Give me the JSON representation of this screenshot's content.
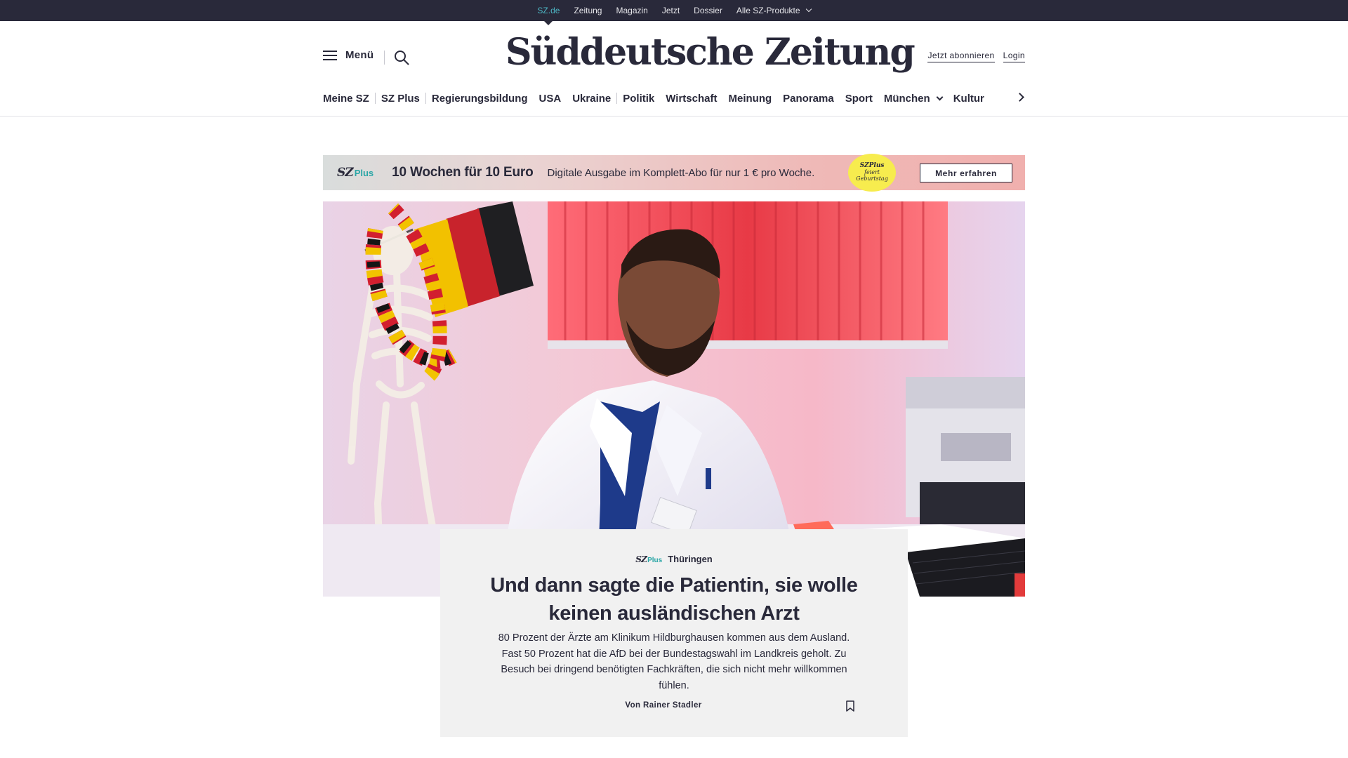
{
  "topbar": {
    "items": [
      {
        "label": "SZ.de",
        "active": true
      },
      {
        "label": "Zeitung"
      },
      {
        "label": "Magazin"
      },
      {
        "label": "Jetzt"
      },
      {
        "label": "Dossier"
      },
      {
        "label": "Alle SZ-Produkte",
        "dropdown": true
      }
    ]
  },
  "header": {
    "menu_label": "Menü",
    "logo": "Süddeutsche Zeitung",
    "subscribe": "Jetzt abonnieren",
    "login": "Login"
  },
  "sections": {
    "items": [
      "Meine SZ",
      "SZ Plus",
      "Regierungsbildung",
      "USA",
      "Ukraine",
      "Politik",
      "Wirtschaft",
      "Meinung",
      "Panorama",
      "Sport",
      "München",
      "Kultur"
    ]
  },
  "promo": {
    "logo_sz": "SZ",
    "logo_plus": "Plus",
    "title": "10 Wochen für 10 Euro",
    "text": "Digitale Ausgabe im Komplett-Abo für nur 1 € pro Woche.",
    "badge_line1": "SZPlus",
    "badge_line2": "feiert",
    "badge_line3": "Geburtstag",
    "button": "Mehr erfahren"
  },
  "article": {
    "kicker_sz": "SZ",
    "kicker_plus": "Plus",
    "topic": "Thüringen",
    "title": "Und dann sagte die Patientin, sie wolle keinen ausländischen Arzt",
    "teaser": "80 Prozent der Ärzte am Klinikum Hildburghausen kommen aus dem Ausland. Fast 50 Prozent hat die AfD bei der Bundestagswahl im Landkreis geholt. Zu Besuch bei dringend benötigten Fachkräften, die sich nicht mehr willkommen fühlen.",
    "author": "Von Rainer Stadler"
  },
  "colors": {
    "ink": "#29293a",
    "accent_teal": "#2aa6a6",
    "topbar_active": "#4db6c4",
    "badge_yellow": "#f7ec4e"
  },
  "icons": [
    "hamburger-icon",
    "search-icon",
    "chevron-down-icon",
    "chevron-right-icon",
    "bookmark-icon"
  ]
}
